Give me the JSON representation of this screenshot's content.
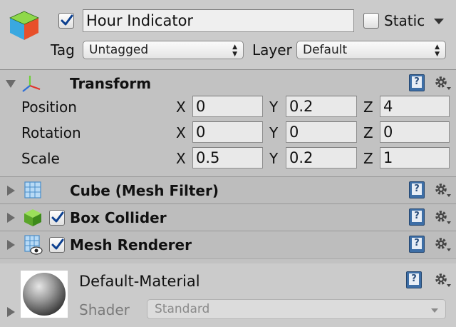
{
  "header": {
    "object_name": "Hour Indicator",
    "active": true,
    "static_label": "Static",
    "static_checked": false,
    "tag_label": "Tag",
    "tag_value": "Untagged",
    "layer_label": "Layer",
    "layer_value": "Default"
  },
  "transform": {
    "title": "Transform",
    "expanded": true,
    "rows": [
      {
        "label": "Position",
        "x": "0",
        "y": "0.2",
        "z": "4"
      },
      {
        "label": "Rotation",
        "x": "0",
        "y": "0",
        "z": "0"
      },
      {
        "label": "Scale",
        "x": "0.5",
        "y": "0.2",
        "z": "1"
      }
    ],
    "axis_labels": {
      "x": "X",
      "y": "Y",
      "z": "Z"
    }
  },
  "components": [
    {
      "title": "Cube (Mesh Filter)",
      "icon": "mesh-filter-icon",
      "has_checkbox": false
    },
    {
      "title": "Box Collider",
      "icon": "box-collider-icon",
      "has_checkbox": true,
      "checked": true
    },
    {
      "title": "Mesh Renderer",
      "icon": "mesh-renderer-icon",
      "has_checkbox": true,
      "checked": true
    }
  ],
  "material": {
    "name": "Default-Material",
    "shader_label": "Shader",
    "shader_value": "Standard"
  },
  "colors": {
    "panel": "#c2c2c2",
    "header": "#cbcbcb",
    "help_blue": "#3d6ea6",
    "check_blue": "#0b3f8f"
  }
}
